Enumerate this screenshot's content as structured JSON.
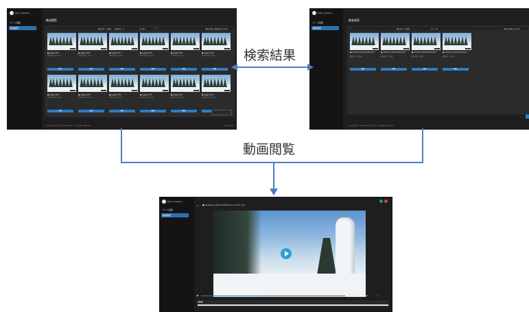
{
  "labels": {
    "search_results": "検索結果",
    "video_view": "動画閲覧"
  },
  "colors": {
    "connector": "#4a7cc4",
    "accent": "#2a7dc9"
  },
  "left_screen": {
    "logo_text": "Mob Linkstore",
    "nav": [
      {
        "label": "ホーム画面"
      },
      {
        "label": "動画閲覧"
      }
    ],
    "title": "動画閲覧",
    "filter": {
      "left": "撮影日時 : 全期間",
      "mid": "撮影場所 : 全",
      "sort": "並べ替え",
      "count": "1 / 2",
      "right": "撮影日時順 / 最新順に並べ替え"
    },
    "cards": [
      {
        "caption": "■ 北海道_0001",
        "sub": "2020/01/12 10:23",
        "badge": "00:15",
        "btn": "閲覧"
      },
      {
        "caption": "■ 北海道_0002",
        "sub": "2020/01/12 10:24",
        "badge": "00:20",
        "btn": "閲覧"
      },
      {
        "caption": "■ 北海道_0003",
        "sub": "2020/01/12 10:25",
        "badge": "00:12",
        "btn": "閲覧"
      },
      {
        "caption": "■ 北海道_0004",
        "sub": "2020/01/12 10:26",
        "badge": "00:18",
        "btn": "閲覧"
      },
      {
        "caption": "■ 北海道_0005",
        "sub": "2020/01/12 10:27",
        "badge": "00:09",
        "btn": "閲覧"
      },
      {
        "caption": "■ 北海道_0006",
        "sub": "2020/01/12 10:28",
        "badge": "00:22",
        "btn": "閲覧"
      },
      {
        "caption": "■ 北海道_0007",
        "sub": "2020/01/12 10:29",
        "badge": "00:16",
        "btn": "閲覧"
      },
      {
        "caption": "■ 北海道_0008",
        "sub": "2020/01/12 10:30",
        "badge": "00:11",
        "btn": "閲覧"
      },
      {
        "caption": "■ 北海道_0009",
        "sub": "2020/01/12 10:31",
        "badge": "00:14",
        "btn": "閲覧"
      },
      {
        "caption": "■ 北海道_0010",
        "sub": "2020/01/12 10:32",
        "badge": "00:19",
        "btn": "閲覧"
      },
      {
        "caption": "■ 北海道_0011",
        "sub": "2020/01/12 10:33",
        "badge": "00:13",
        "btn": "閲覧"
      },
      {
        "caption": "■ 北海道_0012",
        "sub": "2020/01/12 10:34",
        "badge": "00:17",
        "btn": "閲覧"
      }
    ],
    "footer_left": "Copyright © Mob Linkstore Inc. All rights reserved.",
    "footer_right": "Version 1.0"
  },
  "right_screen": {
    "logo_text": "Mob Linkstore",
    "nav": [
      {
        "label": "ホーム画面"
      },
      {
        "label": "動画閲覧"
      }
    ],
    "title": "動画検索",
    "filter": {
      "left": "撮影日時 : 全期間",
      "mid": "タグ : 雪",
      "right": "撮影日時順に並べ替え"
    },
    "cards": [
      {
        "caption": "■ Hokkaido_0003 2020/01/12",
        "sub": "撮影場所 : 北海道",
        "badge": "00:12",
        "btn": "閲覧"
      },
      {
        "caption": "■ Hokkaido_0005 2020/01/12",
        "sub": "撮影場所 : 北海道",
        "badge": "00:09",
        "btn": "閲覧"
      },
      {
        "caption": "■ Hokkaido_0008 2020/01/12",
        "sub": "撮影場所 : 北海道",
        "badge": "00:11",
        "btn": "閲覧"
      },
      {
        "caption": "■ Hokkaido_0011 2020/01/12",
        "sub": "撮影場所 : 北海道",
        "badge": "00:13",
        "btn": "閲覧"
      }
    ],
    "footer_left": "Copyright © Mob Linkstore Inc. All rights reserved."
  },
  "bottom_screen": {
    "logo_text": "Mob Linkstore",
    "nav": [
      {
        "label": "ホーム画面"
      },
      {
        "label": "動画閲覧"
      }
    ],
    "video_title": "■ Hokkaido_0003 2020/01/12 10:25 (12)",
    "time": "00:05 / 00:12",
    "timeline_label": "00:05"
  }
}
